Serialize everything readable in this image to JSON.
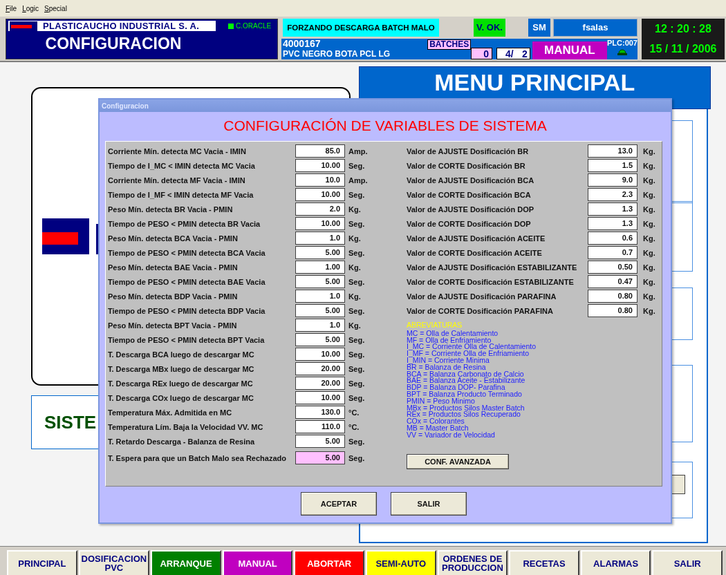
{
  "menu_bar": [
    "File",
    "Logic",
    "Special"
  ],
  "header": {
    "company": "PLASTICAUCHO INDUSTRIAL S. A.",
    "db_status": {
      "label": "C.ORACLE",
      "on": true
    },
    "screen_title": "CONFIGURACION",
    "alert": "FORZANDO DESCARGA BATCH MALO",
    "validation": "V. OK.",
    "user_role": "SM",
    "user": "fsalas",
    "order_number": "4000167",
    "product": "PVC NEGRO BOTA PCL LG",
    "batches_label": "BATCHES",
    "batch_pending": "0",
    "batch_count": "4/",
    "batch_total": "2",
    "mode": "MANUAL",
    "plc": {
      "label": "PLC:007",
      "on": true
    },
    "time": "12 : 20 : 28",
    "date": "15 / 11 / 2006"
  },
  "background": {
    "system_text": "SISTE",
    "menu_title": "MENU PRINCIPAL"
  },
  "dialog": {
    "title": "Configuracion",
    "heading": "CONFIGURACIÓN DE VARIABLES DE SISTEMA",
    "left_params": [
      {
        "label": "Corriente Mín. detecta MC Vacia - IMIN",
        "value": "85.0",
        "unit": "Amp.",
        "highlighted": false
      },
      {
        "label": "Tiempo de I_MC < IMIN detecta MC Vacia",
        "value": "10.00",
        "unit": "Seg.",
        "highlighted": false
      },
      {
        "label": "Corriente Mín. detecta MF Vacia - IMIN",
        "value": "10.0",
        "unit": "Amp.",
        "highlighted": false
      },
      {
        "label": "Tiempo de I_MF < IMIN detecta MF Vacia",
        "value": "10.00",
        "unit": "Seg.",
        "highlighted": false
      },
      {
        "label": "Peso Mín. detecta BR Vacia - PMIN",
        "value": "2.0",
        "unit": "Kg.",
        "highlighted": false
      },
      {
        "label": "Tiempo de PESO < PMIN detecta BR Vacia",
        "value": "10.00",
        "unit": "Seg.",
        "highlighted": false
      },
      {
        "label": "Peso Mín. detecta BCA Vacia - PMIN",
        "value": "1.0",
        "unit": "Kg.",
        "highlighted": false
      },
      {
        "label": "Tiempo de PESO < PMIN detecta BCA Vacia",
        "value": "5.00",
        "unit": "Seg.",
        "highlighted": false
      },
      {
        "label": "Peso Mín. detecta BAE Vacia - PMIN",
        "value": "1.00",
        "unit": "Kg.",
        "highlighted": false
      },
      {
        "label": "Tiempo de PESO < PMIN detecta BAE Vacia",
        "value": "5.00",
        "unit": "Seg.",
        "highlighted": false
      },
      {
        "label": "Peso Mín. detecta BDP Vacia - PMIN",
        "value": "1.0",
        "unit": "Kg.",
        "highlighted": false
      },
      {
        "label": "Tiempo de PESO < PMIN detecta BDP Vacia",
        "value": "5.00",
        "unit": "Seg.",
        "highlighted": false
      },
      {
        "label": "Peso Mín. detecta BPT Vacia - PMIN",
        "value": "1.0",
        "unit": "Kg.",
        "highlighted": false
      },
      {
        "label": "Tiempo de PESO < PMIN detecta BPT Vacia",
        "value": "5.00",
        "unit": "Seg.",
        "highlighted": false
      },
      {
        "label": "T. Descarga BCA luego de descargar MC",
        "value": "10.00",
        "unit": "Seg.",
        "highlighted": false
      },
      {
        "label": "T. Descarga MBx luego de descargar MC",
        "value": "20.00",
        "unit": "Seg.",
        "highlighted": false
      },
      {
        "label": "T. Descarga REx luego de descargar MC",
        "value": "20.00",
        "unit": "Seg.",
        "highlighted": false
      },
      {
        "label": "T. Descarga COx luego de descargar MC",
        "value": "10.00",
        "unit": "Seg.",
        "highlighted": false
      },
      {
        "label": "Temperatura Máx. Admitida en MC",
        "value": "130.0",
        "unit": "°C.",
        "highlighted": false
      },
      {
        "label": "Temperatura Lím. Baja la Velocidad VV. MC",
        "value": "110.0",
        "unit": "°C.",
        "highlighted": false
      },
      {
        "label": "T. Retardo Descarga - Balanza de Resina",
        "value": "5.00",
        "unit": "Seg.",
        "highlighted": false
      },
      {
        "label": "T. Espera para que un Batch Malo sea Rechazado",
        "value": "5.00",
        "unit": "Seg.",
        "highlighted": true
      }
    ],
    "right_params": [
      {
        "label": "Valor de AJUSTE Dosificación BR",
        "value": "13.0",
        "unit": "Kg.",
        "highlighted": false
      },
      {
        "label": "Valor de CORTE Dosificación BR",
        "value": "1.5",
        "unit": "Kg.",
        "highlighted": false
      },
      {
        "label": "Valor de AJUSTE Dosificación BCA",
        "value": "9.0",
        "unit": "Kg.",
        "highlighted": false
      },
      {
        "label": "Valor de CORTE Dosificación BCA",
        "value": "2.3",
        "unit": "Kg.",
        "highlighted": false
      },
      {
        "label": "Valor de AJUSTE Dosificación DOP",
        "value": "1.3",
        "unit": "Kg.",
        "highlighted": false
      },
      {
        "label": "Valor de CORTE Dosificación DOP",
        "value": "1.3",
        "unit": "Kg.",
        "highlighted": false
      },
      {
        "label": "Valor de AJUSTE Dosificación ACEITE",
        "value": "0.6",
        "unit": "Kg.",
        "highlighted": false
      },
      {
        "label": "Valor de CORTE Dosificación ACEITE",
        "value": "0.7",
        "unit": "Kg.",
        "highlighted": false
      },
      {
        "label": "Valor de AJUSTE Dosificación ESTABILIZANTE",
        "value": "0.50",
        "unit": "Kg.",
        "highlighted": false
      },
      {
        "label": "Valor de CORTE Dosificación ESTABILIZANTE",
        "value": "0.47",
        "unit": "Kg.",
        "highlighted": false
      },
      {
        "label": "Valor de AJUSTE Dosificación PARAFINA",
        "value": "0.80",
        "unit": "Kg.",
        "highlighted": false
      },
      {
        "label": "Valor de CORTE Dosificación PARAFINA",
        "value": "0.80",
        "unit": "Kg.",
        "highlighted": false
      }
    ],
    "abbreviations_title": "ABREVIATURAS",
    "abbreviations": [
      "MC = Olla de Calentamiento",
      "MF = Olla de Enfriamiento",
      "I_MC = Corriente Olla de Calentamiento",
      "I_MF = Corriente Olla de Enfriamiento",
      "I_MIN = Corriente Minima",
      "BR = Balanza de Resina",
      "BCA = Balanza Carbonato de Calcio",
      "BAE = Balanza Aceite - Estabilizante",
      "BDP = Balanza DOP- Parafina",
      "BPT = Balanza Producto Terminado",
      "PMIN = Peso Minimo",
      "MBx = Productos Silos Master Batch",
      "REx = Productos Silos Recuperado",
      "COx = Colorantes",
      "MB = Master Batch",
      "VV = Variador de Velocidad"
    ],
    "advanced_button": "CONF. AVANZADA",
    "buttons": [
      "ACEPTAR",
      "SALIR"
    ]
  },
  "nav_buttons": [
    {
      "label": "PRINCIPAL",
      "color": "#ece9d8"
    },
    {
      "label": "DOSIFICACION PVC",
      "color": "#ece9d8"
    },
    {
      "label": "ARRANQUE",
      "color": "#008000"
    },
    {
      "label": "MANUAL",
      "color": "#c000c0"
    },
    {
      "label": "ABORTAR",
      "color": "#ff0000"
    },
    {
      "label": "SEMI-AUTO",
      "color": "#ffff00"
    },
    {
      "label": "ORDENES DE PRODUCCION",
      "color": "#ece9d8"
    },
    {
      "label": "RECETAS",
      "color": "#ece9d8"
    },
    {
      "label": "ALARMAS",
      "color": "#ece9d8"
    },
    {
      "label": "SALIR",
      "color": "#ece9d8"
    }
  ]
}
